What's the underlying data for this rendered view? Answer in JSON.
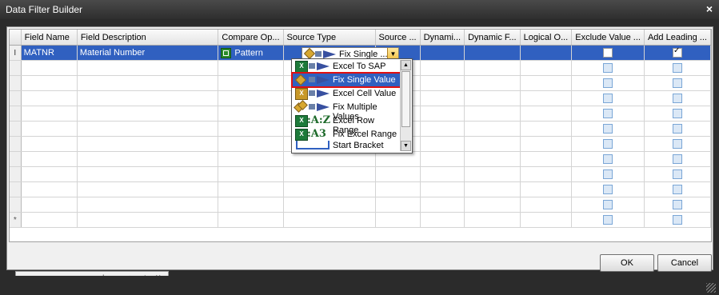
{
  "window": {
    "title": "Data Filter Builder",
    "close_glyph": "×"
  },
  "grid": {
    "columns": [
      {
        "key": "field_name",
        "label": "Field Name"
      },
      {
        "key": "field_desc",
        "label": "Field Description"
      },
      {
        "key": "compare_op",
        "label": "Compare Op..."
      },
      {
        "key": "source_type",
        "label": "Source Type"
      },
      {
        "key": "source",
        "label": "Source ..."
      },
      {
        "key": "dynami",
        "label": "Dynami..."
      },
      {
        "key": "dynamic_f",
        "label": "Dynamic F..."
      },
      {
        "key": "logical_o",
        "label": "Logical O..."
      },
      {
        "key": "exclude",
        "label": "Exclude Value ..."
      },
      {
        "key": "add_leading",
        "label": "Add Leading ..."
      }
    ],
    "row1": {
      "indicator": "I",
      "field_name": "MATNR",
      "field_desc": "Material Number",
      "compare_op": "Pattern",
      "source_type": "Fix Single ...",
      "exclude_checked": false,
      "add_leading_checked": true
    },
    "new_row_indicator": "*"
  },
  "dropdown": {
    "selected": "Fix Single Value",
    "items": [
      {
        "label": "Excel To SAP",
        "icon": "excel-to-sap-icon"
      },
      {
        "label": "Fix Single Value",
        "icon": "fix-single-value-icon"
      },
      {
        "label": "Excel Cell Value",
        "icon": "excel-cell-value-icon"
      },
      {
        "label": "Fix Multiple Values",
        "icon": "fix-multiple-values-icon"
      },
      {
        "label": "Excel Row Range",
        "icon": "excel-row-range-icon",
        "glyph": ":A:Z"
      },
      {
        "label": "Fix Excel Range",
        "icon": "fix-excel-range-icon",
        "glyph": ":A3"
      },
      {
        "label": "Start Bracket",
        "icon": "start-bracket-icon"
      }
    ]
  },
  "navigator": {
    "glyphs": [
      "⏮",
      "«",
      "‹",
      "›",
      "»",
      "⏭",
      "+",
      "−",
      "▲",
      "✓",
      "✕"
    ]
  },
  "buttons": {
    "ok": "OK",
    "cancel": "Cancel"
  },
  "colors": {
    "selection": "#3060c0",
    "highlight_border": "#e01010",
    "excel_green": "#1d7a3a"
  }
}
